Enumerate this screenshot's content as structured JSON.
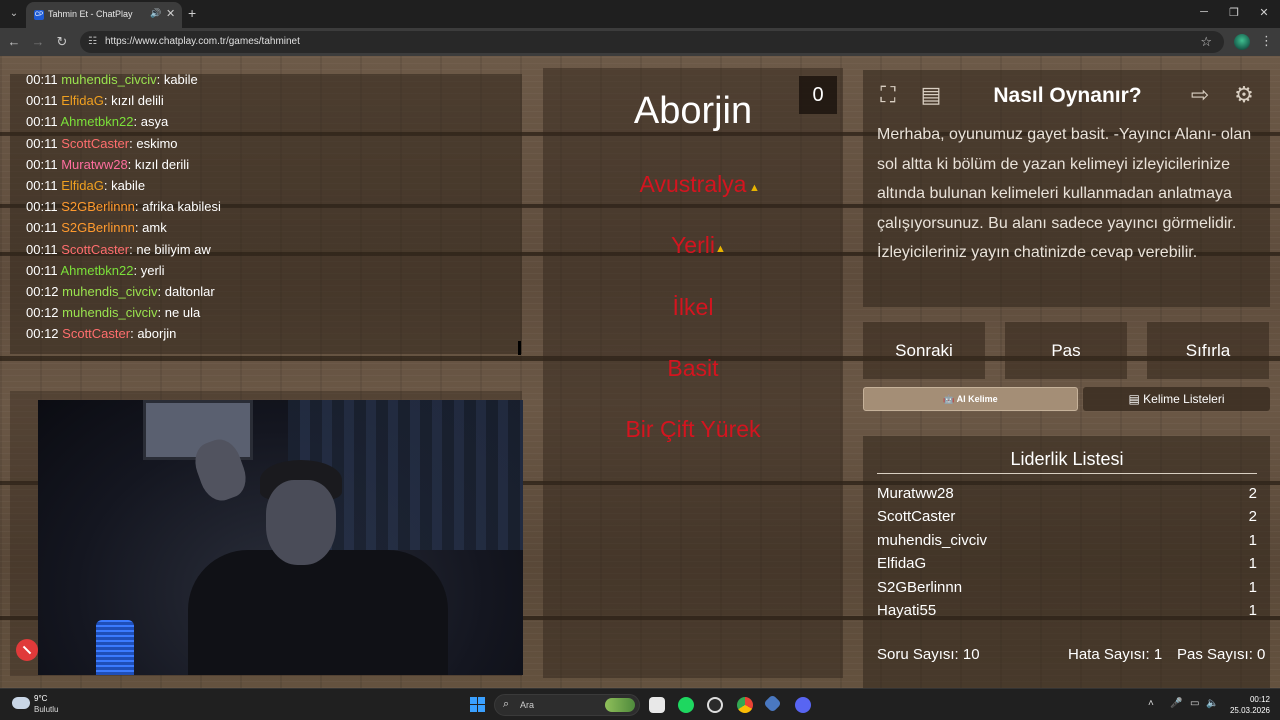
{
  "browser": {
    "tab_title": "Tahmin Et - ChatPlay",
    "tab_favicon": "CP",
    "url": "https://www.chatplay.com.tr/games/tahminet"
  },
  "chat": {
    "messages": [
      {
        "time": "00:11",
        "user": "muhendis_civciv",
        "color": "#9ae34f",
        "text": "kabile"
      },
      {
        "time": "00:11",
        "user": "ElfidaG",
        "color": "#f0a020",
        "text": "kızıl delili"
      },
      {
        "time": "00:11",
        "user": "Ahmetbkn22",
        "color": "#7be03a",
        "text": "asya"
      },
      {
        "time": "00:11",
        "user": "ScottCaster",
        "color": "#ff6e6e",
        "text": "eskimo"
      },
      {
        "time": "00:11",
        "user": "Muratww28",
        "color": "#ff6e9e",
        "text": "kızıl derili"
      },
      {
        "time": "00:11",
        "user": "ElfidaG",
        "color": "#f0a020",
        "text": "kabile"
      },
      {
        "time": "00:11",
        "user": "S2GBerlinnn",
        "color": "#ff9a2e",
        "text": "afrika kabilesi"
      },
      {
        "time": "00:11",
        "user": "S2GBerlinnn",
        "color": "#ff9a2e",
        "text": "amk"
      },
      {
        "time": "00:11",
        "user": "ScottCaster",
        "color": "#ff6e6e",
        "text": "ne biliyim aw"
      },
      {
        "time": "00:11",
        "user": "Ahmetbkn22",
        "color": "#7be03a",
        "text": "yerli"
      },
      {
        "time": "00:12",
        "user": "muhendis_civciv",
        "color": "#9ae34f",
        "text": "daltonlar"
      },
      {
        "time": "00:12",
        "user": "muhendis_civciv",
        "color": "#9ae34f",
        "text": "ne ula"
      },
      {
        "time": "00:12",
        "user": "ScottCaster",
        "color": "#ff6e6e",
        "text": "aborjin"
      }
    ]
  },
  "game": {
    "counter": "0",
    "main_word": "Aborjin",
    "taboo_words": [
      "Avustralya",
      "Yerli",
      "İlkel",
      "Basit",
      "Bir Çift Yürek"
    ]
  },
  "howto": {
    "title": "Nasıl Oynanır?",
    "text": "Merhaba, oyunumuz gayet basit. -Yayıncı Alanı- olan sol altta ki bölüm de yazan kelimeyi izleyicilerinize altında bulunan kelimeleri kullanmadan anlatmaya çalışıyorsunuz. Bu alanı sadece yayıncı görmelidir. İzleyicileriniz yayın chatinizde cevap verebilir."
  },
  "actions": {
    "next": "Sonraki",
    "pass": "Pas",
    "reset": "Sıfırla",
    "ai_word": "AI Kelime",
    "word_lists": "Kelime Listeleri"
  },
  "leaderboard": {
    "title": "Liderlik Listesi",
    "rows": [
      {
        "name": "Muratww28",
        "score": "2"
      },
      {
        "name": "ScottCaster",
        "score": "2"
      },
      {
        "name": "muhendis_civciv",
        "score": "1"
      },
      {
        "name": "ElfidaG",
        "score": "1"
      },
      {
        "name": "S2GBerlinnn",
        "score": "1"
      },
      {
        "name": "Hayati55",
        "score": "1"
      }
    ],
    "stats": {
      "questions": "Soru Sayısı: 10",
      "errors": "Hata Sayısı: 1",
      "passes": "Pas Sayısı: 0"
    }
  },
  "taskbar": {
    "weather_temp": "9°C",
    "weather_desc": "Bulutlu",
    "search_placeholder": "Ara",
    "time": "00:12",
    "date": "25.03.2026"
  },
  "colors": {
    "taboo_red": "#d4141f",
    "warning": "#e8b400"
  }
}
